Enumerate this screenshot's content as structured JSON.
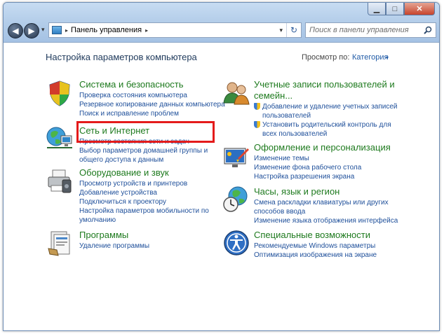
{
  "window": {
    "caption": {
      "minimize": "▁",
      "maximize": "□",
      "close": "✕"
    },
    "nav": {
      "back": "◀",
      "forward": "▶",
      "dropdown": "▾"
    },
    "address": {
      "breadcrumb": "Панель управления",
      "sep_before": "▸",
      "sep_after": "▸",
      "dropdown": "▾",
      "refresh": "↻"
    },
    "search": {
      "placeholder": "Поиск в панели управления",
      "icon": "search-icon"
    }
  },
  "content": {
    "heading": "Настройка параметров компьютера",
    "view_by_label": "Просмотр по:",
    "view_by_value": "Категория",
    "view_by_caret": "▾"
  },
  "categories": {
    "system": {
      "title": "Система и безопасность",
      "icon": "shield-icon",
      "links": [
        "Проверка состояния компьютера",
        "Резервное копирование данных компьютера",
        "Поиск и исправление проблем"
      ]
    },
    "network": {
      "title": "Сеть и Интернет",
      "icon": "network-globe-icon",
      "links": [
        "Просмотр состояния сети и задач",
        "Выбор параметров домашней группы и",
        "общего доступа к данным"
      ]
    },
    "hardware": {
      "title": "Оборудование и звук",
      "icon": "printer-icon",
      "links": [
        "Просмотр устройств и принтеров",
        "Добавление устройства",
        "Подключиться к проектору",
        "Настройка параметров мобильности по",
        "умолчанию"
      ]
    },
    "programs": {
      "title": "Программы",
      "icon": "programs-icon",
      "links": [
        "Удаление программы"
      ]
    },
    "users": {
      "title_line1": "Учетные записи пользователей и",
      "title_line2": "семейн...",
      "icon": "users-icon",
      "links": [
        "Добавление и удаление учетных записей",
        "пользователей",
        "Установить родительский контроль для",
        "всех пользователей"
      ]
    },
    "appearance": {
      "title": "Оформление и персонализация",
      "icon": "appearance-icon",
      "links": [
        "Изменение темы",
        "Изменение фона рабочего стола",
        "Настройка разрешения экрана"
      ]
    },
    "clock": {
      "title": "Часы, язык и регион",
      "icon": "clock-globe-icon",
      "links": [
        "Смена раскладки клавиатуры или других",
        "способов ввода",
        "Изменение языка отображения интерфейса"
      ]
    },
    "access": {
      "title": "Специальные возможности",
      "icon": "accessibility-icon",
      "links": [
        "Рекомендуемые Windows параметры",
        "Оптимизация изображения на экране"
      ]
    }
  },
  "colors": {
    "category_title": "#1e7a1e",
    "link": "#1e4f9a",
    "highlight": "#e41b1b"
  }
}
